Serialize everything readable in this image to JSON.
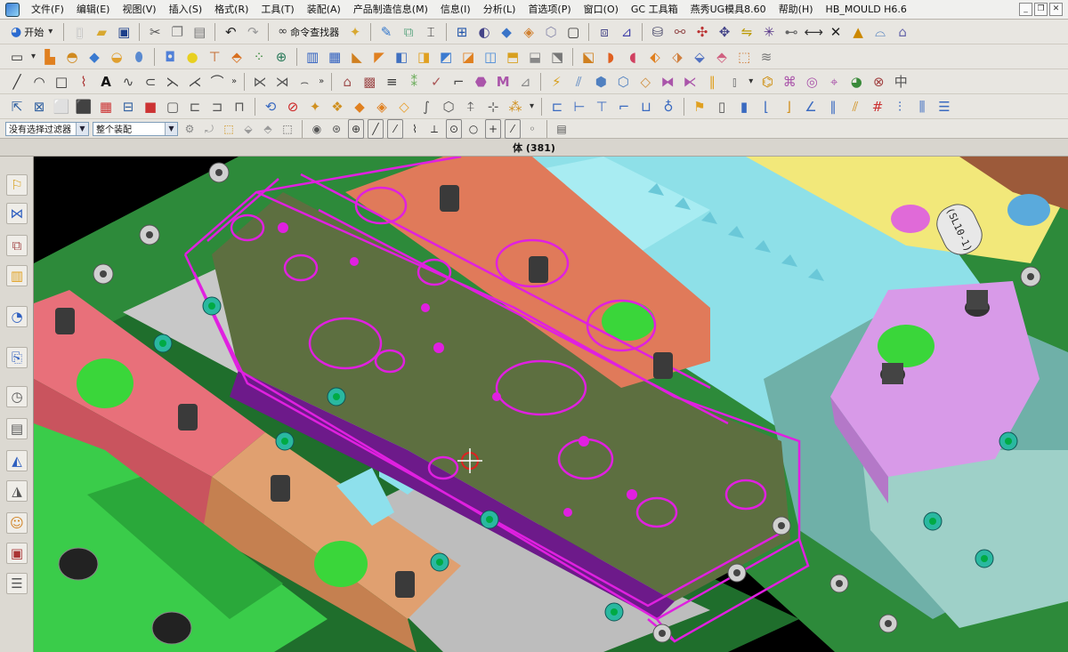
{
  "menubar": {
    "items": [
      "文件(F)",
      "编辑(E)",
      "视图(V)",
      "插入(S)",
      "格式(R)",
      "工具(T)",
      "装配(A)",
      "产品制造信息(M)",
      "信息(I)",
      "分析(L)",
      "首选项(P)",
      "窗口(O)",
      "GC 工具箱",
      "燕秀UG模具8.60",
      "帮助(H)",
      "HB_MOULD H6.6"
    ],
    "win_minimize": "_",
    "win_restore": "❐",
    "win_close": "✕"
  },
  "toolbar": {
    "start_label": "开始",
    "command_finder_label": "命令查找器"
  },
  "selection_bar": {
    "filter": "没有选择过滤器",
    "scope": "整个装配"
  },
  "status": {
    "text": "体 (381)"
  },
  "viewport": {
    "part_label": "(SL10-1)"
  },
  "colors": {
    "selection": "#e020e0",
    "background": "#000000",
    "plate_green": "#2d8a3a",
    "block_red": "#e8707a",
    "block_orange": "#e0a070",
    "slider_violet": "#d89ae8",
    "cyan_core": "#8ee0e8",
    "yellow_block": "#f2e87a"
  }
}
